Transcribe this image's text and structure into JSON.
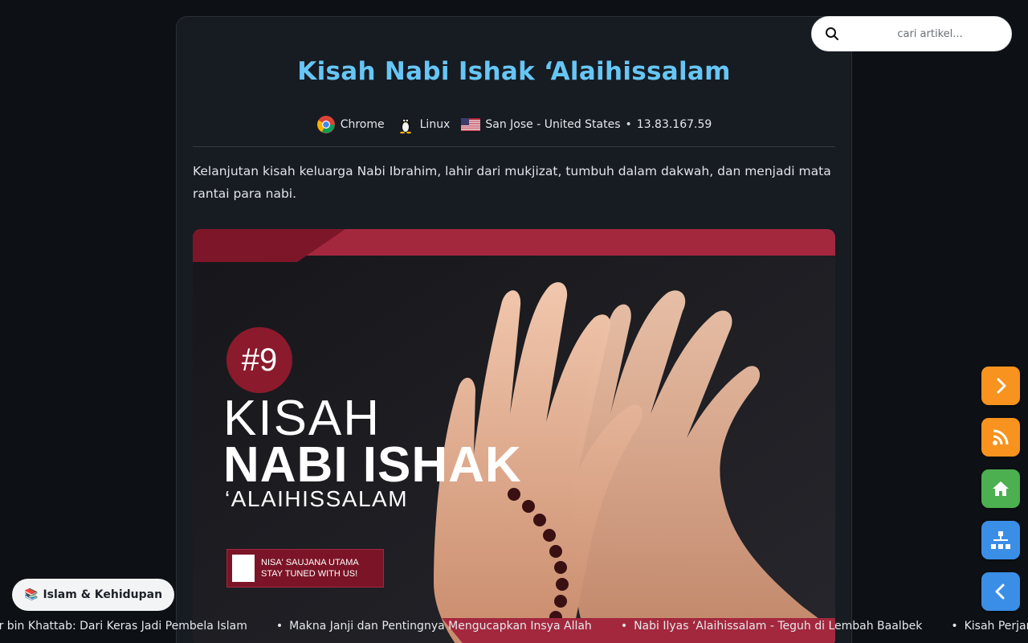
{
  "article": {
    "title": "Kisah Nabi Ishak ‘Alaihissalam",
    "meta": {
      "browser": "Chrome",
      "os": "Linux",
      "location": "San Jose - United States",
      "separator": "•",
      "ip": "13.83.167.59"
    },
    "lead": "Kelanjutan kisah keluarga Nabi Ibrahim, lahir dari mukjizat, tumbuh dalam dakwah, dan menjadi mata rantai para nabi.",
    "hero": {
      "badge": "#9",
      "line1": "KISAH",
      "line2": "NABI ISHAK",
      "line3": "‘ALAIHISSALAM",
      "brand_line1": "NISA' SAUJANA UTAMA",
      "brand_line2": "STAY TUNED WITH US!",
      "accent_color": "#a3283e"
    }
  },
  "search": {
    "placeholder": "cari artikel..."
  },
  "fabs": [
    {
      "name": "next-icon",
      "color": "#f7931e"
    },
    {
      "name": "rss-icon",
      "color": "#f7931e"
    },
    {
      "name": "home-icon",
      "color": "#4caf50"
    },
    {
      "name": "sitemap-icon",
      "color": "#3a8ee6"
    },
    {
      "name": "back-icon",
      "color": "#3a8ee6"
    }
  ],
  "category": {
    "icon": "📚",
    "label": "Islam & Kehidupan"
  },
  "ticker": {
    "items": [
      "ar bin Khattab: Dari Keras Jadi Pembela Islam",
      "Makna Janji dan Pentingnya Mengucapkan Insya Allah",
      "Nabi Ilyas ‘Alaihissalam - Teguh di Lembah Baalbek",
      "Kisah Perjanjian"
    ],
    "bullet": "•"
  }
}
